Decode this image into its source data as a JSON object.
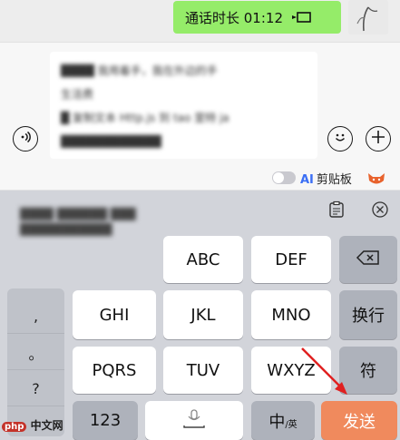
{
  "chat": {
    "call_bubble_text": "通话时长 01:12",
    "bubble_color": "#95ec69"
  },
  "input": {
    "text_lines": [
      "████ 我用着手，我在外边的手",
      "生活费",
      "█ 复制文本 Http.js 到 tao 里特 ja",
      "████████████"
    ],
    "voice_icon": "voice-icon",
    "emoji_icon": "emoji-icon",
    "plus_icon": "plus-icon"
  },
  "toolbar": {
    "ai_prefix": "AI",
    "clipboard_label": "剪贴板",
    "toggle_state": "off"
  },
  "candidates": {
    "blurred_text": [
      "████ ██████ ███",
      "███████████"
    ]
  },
  "keyboard": {
    "left_panel": [
      ",",
      "。",
      "?",
      "!"
    ],
    "rows": [
      [
        "ABC",
        "DEF"
      ],
      [
        "GHI",
        "JKL",
        "MNO"
      ],
      [
        "PQRS",
        "TUV",
        "WXYZ"
      ]
    ],
    "return_label": "换行",
    "symbol_label": "符",
    "num_label": "123",
    "lang_label": "中",
    "lang_sub_label": "/英",
    "send_label": "发送",
    "send_color": "#f08a5d"
  },
  "watermark": {
    "text": "php 中文网"
  }
}
